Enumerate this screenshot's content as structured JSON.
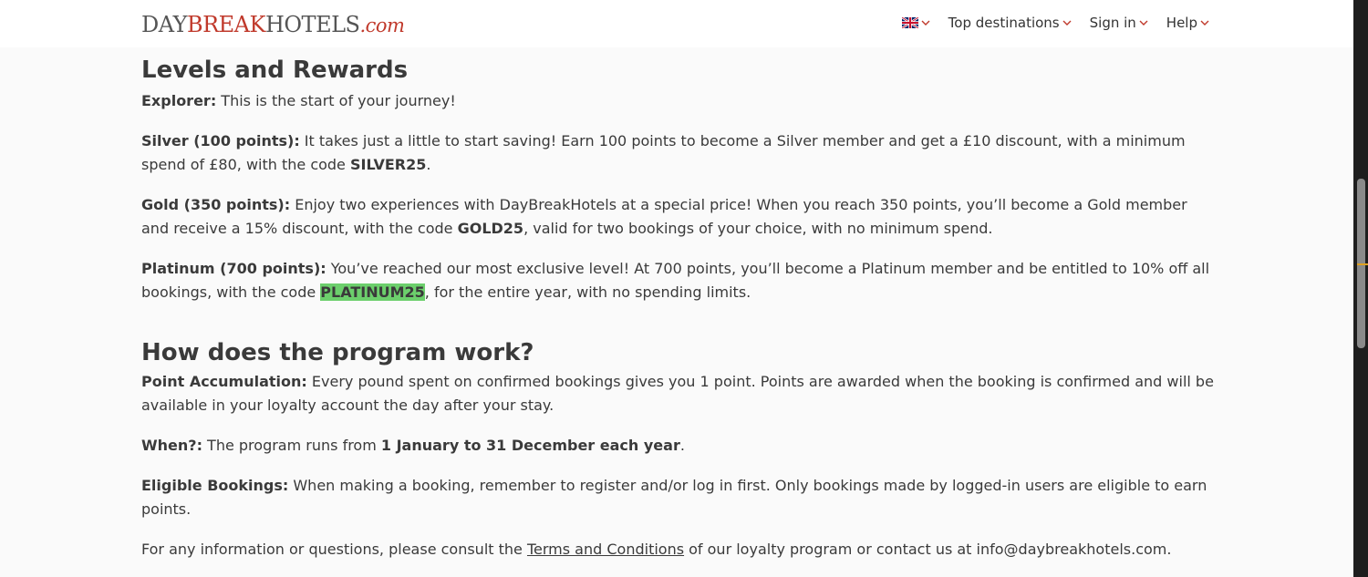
{
  "header": {
    "logo": {
      "part1": "DAY",
      "part2": "BREAK",
      "part3": "HOTELS",
      "part4": ".com"
    },
    "nav": {
      "language_icon": "uk-flag-icon",
      "destinations": "Top destinations",
      "sign_in": "Sign in",
      "help": "Help"
    },
    "accent_color": "#c0392b"
  },
  "levels": {
    "title": "Levels and Rewards",
    "explorer": {
      "label": "Explorer:",
      "text": " This is the start of your journey!"
    },
    "silver": {
      "label": "Silver (100 points):",
      "text1": " It takes just a little to start saving! Earn 100 points to become a Silver member and get a £10 discount, with a minimum spend of £80, with the code ",
      "code": "SILVER25",
      "text2": "."
    },
    "gold": {
      "label": "Gold (350 points):",
      "text1": " Enjoy two experiences with DayBreakHotels at a special price! When you reach 350 points, you’ll become a Gold member and receive a 15% discount, with the code ",
      "code": "GOLD25",
      "text2": ", valid for two bookings of your choice, with no minimum spend."
    },
    "platinum": {
      "label": "Platinum (700 points):",
      "text1": " You’ve reached our most exclusive level! At 700 points, you’ll become a Platinum member and be entitled to 10% off all bookings, with the code ",
      "code": "PLATINUM25",
      "text2": ", for the entire year, with no spending limits."
    }
  },
  "program": {
    "title": "How does the program work?",
    "accumulation": {
      "label": "Point Accumulation:",
      "text": " Every pound spent on confirmed bookings gives you 1 point. Points are awarded when the booking is confirmed and will be available in your loyalty account the day after your stay."
    },
    "when": {
      "label": "When?:",
      "text1": " The program runs from ",
      "bold": "1 January to 31 December each year",
      "text2": "."
    },
    "eligible": {
      "label": "Eligible Bookings:",
      "text": " When making a booking, remember to register and/or log in first. Only bookings made by logged-in users are eligible to earn points."
    },
    "contact": {
      "text1": "For any information or questions, please consult the ",
      "link": "Terms and Conditions",
      "text2": " of our loyalty program or contact us at info@daybreakhotels.com."
    }
  },
  "highlight_color": "#6ccf6c"
}
